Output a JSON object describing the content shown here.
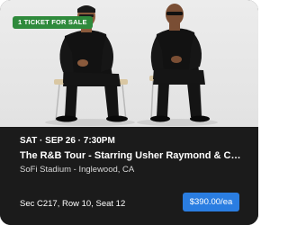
{
  "listing": {
    "badge": "1 TICKET FOR SALE",
    "date": "SAT · SEP 26 · 7:30PM",
    "title": "The R&B Tour - Starring Usher Raymond & Chris…",
    "venue": "SoFi Stadium - Inglewood, CA",
    "seat": "Sec C217, Row 10, Seat 12",
    "price": "$390.00/ea"
  },
  "colors": {
    "badge_bg": "#2f8a3c",
    "price_bg": "#2a7de1",
    "card_bg": "#1b1b1b"
  }
}
